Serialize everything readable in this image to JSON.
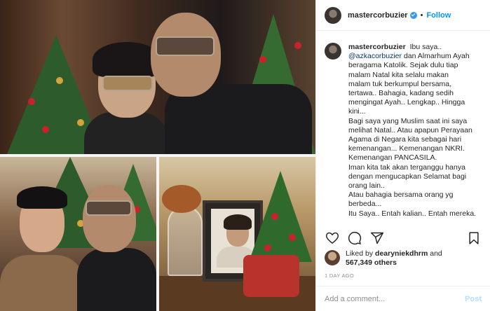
{
  "post": {
    "username": "mastercorbuzier",
    "separator": "•",
    "follow_label": "Follow",
    "caption_lines": [
      "Ibu saya..",
      "@azkacorbuzier dan Almarhum Ayah",
      "beragama Katolik. Sejak dulu tiap",
      "malam Natal kita selalu makan",
      "malam tuk berkumpul bersama,",
      "tertawa.. Bahagia, kadang sedih",
      "mengingat Ayah.. Lengkap.. Hingga",
      "kini...",
      "Bagi saya yang Muslim saat ini saya",
      "melihat Natal.. Atau apapun Perayaan",
      "Agama di Negara kita sebagai hari",
      "kemenangan... Kemenangan NKRI.",
      "Kemenangan PANCASILA.",
      "Iman kita tak akan terganggu hanya",
      "dengan mengucapkan Selamat bagi",
      "orang lain..",
      "Atau bahagia bersama orang yg",
      "berbeda...",
      "Itu Saya.. Entah kalian.. Entah mereka."
    ],
    "mention": "@azkacorbuzier",
    "mention_rest": " dan Almarhum Ayah",
    "liked_by_prefix": "Liked by",
    "liked_by_user": "dearyniekdhrm",
    "liked_by_and": "and",
    "likes_count": "567,349 others",
    "time_ago": "1 DAY AGO",
    "comment_placeholder": "Add a comment...",
    "post_label": "Post"
  },
  "icons": {
    "like": "heart-icon",
    "comment": "comment-icon",
    "share": "share-icon",
    "save": "bookmark-icon",
    "verified": "verified-badge-icon"
  },
  "colors": {
    "follow": "#0095f6",
    "verified": "#3897f0",
    "mention": "#00376b",
    "post_disabled": "#b2dffc",
    "muted": "#8e8e8e"
  }
}
